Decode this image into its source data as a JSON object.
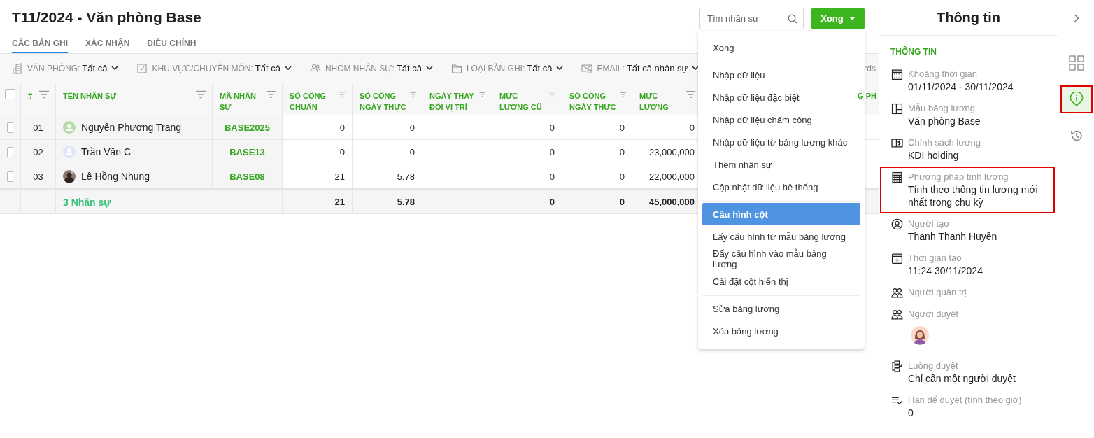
{
  "title": "T11/2024 - Văn phòng Base",
  "tabs": [
    {
      "label": "CÁC BẢN GHI",
      "selected": true
    },
    {
      "label": "XÁC NHẬN",
      "selected": false
    },
    {
      "label": "ĐIỀU CHỈNH",
      "selected": false
    }
  ],
  "search": {
    "placeholder": "Tìm nhân sự"
  },
  "done_button": {
    "label": "Xong"
  },
  "menu": {
    "groups": [
      [
        {
          "label": "Xong",
          "selected": false
        }
      ],
      [
        {
          "label": "Nhập dữ liệu",
          "selected": false
        },
        {
          "label": "Nhập dữ liệu đặc biệt",
          "selected": false
        },
        {
          "label": "Nhập dữ liệu chấm công",
          "selected": false
        },
        {
          "label": "Nhập dữ liệu từ bảng lương khác",
          "selected": false
        },
        {
          "label": "Thêm nhân sự",
          "selected": false
        },
        {
          "label": "Cập nhật dữ liệu hệ thống",
          "selected": false
        }
      ],
      [
        {
          "label": "Cấu hình cột",
          "selected": true
        },
        {
          "label": "Lấy cấu hình từ mẫu bảng lương",
          "selected": false
        },
        {
          "label": "Đẩy cấu hình vào mẫu bảng lương",
          "selected": false
        },
        {
          "label": "Cài đặt cột hiển thị",
          "selected": false
        }
      ],
      [
        {
          "label": "Sửa bảng lương",
          "selected": false
        },
        {
          "label": "Xóa bảng lương",
          "selected": false
        }
      ]
    ]
  },
  "filters": [
    {
      "label": "VĂN PHÒNG:",
      "value": "Tất cả"
    },
    {
      "label": "KHU VỰC/CHUYÊN MÔN:",
      "value": "Tất cả"
    },
    {
      "label": "NHÓM NHÂN SỰ:",
      "value": "Tất cả"
    },
    {
      "label": "LOẠI BẢN GHI:",
      "value": "Tất cả"
    },
    {
      "label": "EMAIL:",
      "value": "Tất cả nhân sự"
    }
  ],
  "filter_bar_trailing": "rds",
  "table": {
    "select_all_checked": false,
    "columns": [
      {
        "label": "#"
      },
      {
        "label": "TÊN NHÂN SỰ"
      },
      {
        "label": "MÃ NHÂN SỰ"
      },
      {
        "label": "SỐ CÔNG CHUẨN"
      },
      {
        "label": "SỐ CÔNG NGÀY THỰC"
      },
      {
        "label": "NGÀY THAY ĐỔI VỊ TRÍ"
      },
      {
        "label": "MỨC LƯƠNG CŨ"
      },
      {
        "label": "SỐ CÔNG NGÀY THỰC"
      },
      {
        "label": "MỨC LƯƠNG"
      },
      {
        "label": "G PH"
      }
    ],
    "rows": [
      {
        "checked": false,
        "index": "01",
        "name": "Nguyễn Phương Trang",
        "avatar": {
          "kind": "icon",
          "color": "#b5dcaa"
        },
        "code": "BASE2025",
        "cells": [
          "0",
          "0",
          "",
          "0",
          "0",
          "0"
        ]
      },
      {
        "checked": false,
        "index": "02",
        "name": "Trần Văn C",
        "avatar": {
          "kind": "icon",
          "color": "#dfe3fb"
        },
        "code": "BASE13",
        "cells": [
          "0",
          "0",
          "",
          "0",
          "0",
          "23,000,000"
        ]
      },
      {
        "checked": false,
        "index": "03",
        "name": "Lê Hồng Nhung",
        "code": "BASE08",
        "cells": [
          "21",
          "5.78",
          "",
          "0",
          "0",
          "22,000,000"
        ]
      }
    ],
    "footer": {
      "label": "3 Nhân sự",
      "cells": [
        "21",
        "5.78",
        "",
        "0",
        "0",
        "45,000,000"
      ]
    }
  },
  "panel": {
    "title": "Thông tin",
    "section": "THÔNG TIN",
    "fields": [
      {
        "kind": "text",
        "label": "Khoảng thời gian",
        "value": "01/11/2024 - 30/11/2024",
        "highlighted": false
      },
      {
        "kind": "text",
        "label": "Mẫu bảng lương",
        "value": "Văn phòng Base",
        "highlighted": false
      },
      {
        "kind": "text",
        "label": "Chính sách lương",
        "value": "KDI holding",
        "highlighted": false
      },
      {
        "kind": "text",
        "label": "Phương pháp tính lương",
        "value": "Tính theo thông tin lương mới nhất trong chu kỳ",
        "highlighted": true
      },
      {
        "kind": "text",
        "label": "Người tạo",
        "value": "Thanh Thanh Huyền",
        "highlighted": false
      },
      {
        "kind": "text",
        "label": "Thời gian tạo",
        "value": "11:24 30/11/2024",
        "highlighted": false
      },
      {
        "kind": "empty",
        "label": "Người quản trị",
        "highlighted": false
      },
      {
        "kind": "avatar",
        "label": "Người duyệt",
        "highlighted": false
      },
      {
        "kind": "text",
        "label": "Luồng duyệt",
        "value": "Chỉ cần một người duyệt",
        "highlighted": false
      },
      {
        "kind": "text",
        "label": "Hạn để duyệt (tính theo giờ)",
        "value": "0",
        "highlighted": false
      }
    ]
  },
  "rail": {
    "items": [
      {
        "selected": false,
        "highlighted": false
      },
      {
        "selected": true,
        "highlighted": true
      },
      {
        "selected": false,
        "highlighted": false
      }
    ]
  }
}
